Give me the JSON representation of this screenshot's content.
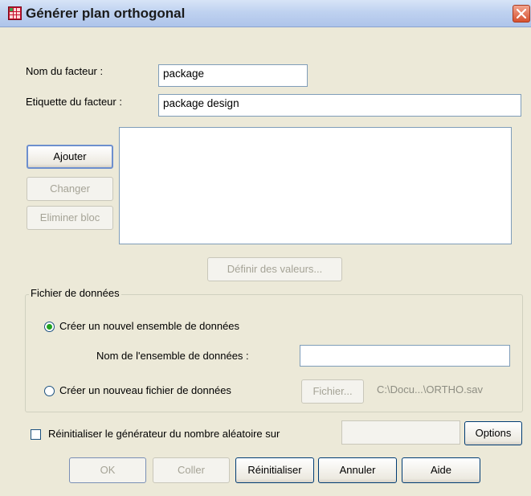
{
  "window": {
    "title": "Générer plan orthogonal"
  },
  "factor": {
    "name_label": "Nom du facteur :",
    "name_value": "package",
    "label_label": "Etiquette du facteur :",
    "label_value": "package design"
  },
  "list_buttons": {
    "add": "Ajouter",
    "change": "Changer",
    "remove": "Eliminer bloc"
  },
  "define_values_button": "Définir des valeurs...",
  "data_file": {
    "group_title": "Fichier de données",
    "new_dataset_radio": "Créer un nouvel ensemble de données",
    "dataset_name_label": "Nom de l'ensemble de données :",
    "dataset_name_value": "",
    "new_file_radio": "Créer un nouveau fichier de données",
    "file_button": "Fichier...",
    "file_path": "C:\\Docu...\\ORTHO.sav"
  },
  "random_seed": {
    "checkbox_label": "Réinitialiser le générateur du nombre aléatoire sur",
    "value": "",
    "options_button": "Options"
  },
  "footer": {
    "ok": "OK",
    "paste": "Coller",
    "reset": "Réinitialiser",
    "cancel": "Annuler",
    "help": "Aide"
  },
  "colors": {
    "dialog_bg": "#ece9d8",
    "input_border": "#7f9db9",
    "close_button": "#d6512f",
    "radio_selected": "#21a121"
  }
}
